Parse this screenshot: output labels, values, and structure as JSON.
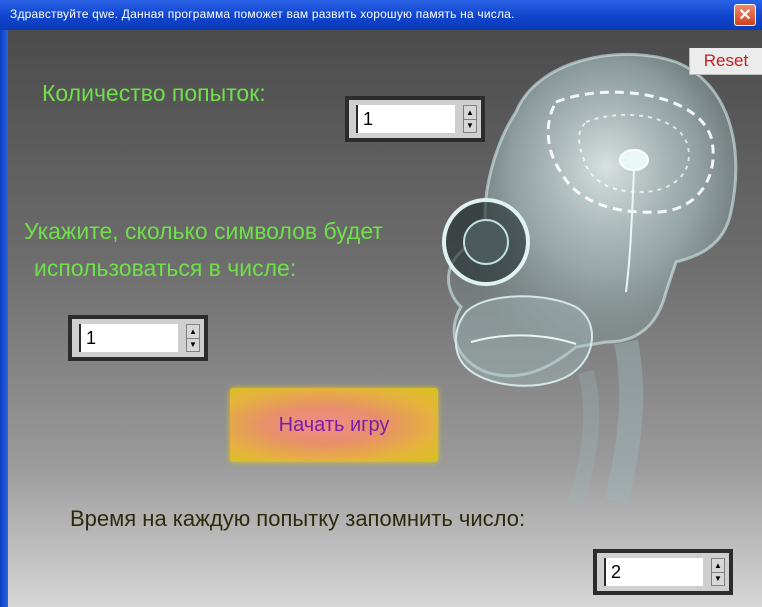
{
  "window": {
    "title": "Здравствуйте qwe. Данная программа поможет вам развить хорошую память на числа.",
    "close_icon": "✕"
  },
  "reset_label": "Reset",
  "attempts": {
    "label": "Количество попыток:",
    "value": "1"
  },
  "digits": {
    "label_line1": "Укажите, сколько символов будет",
    "label_line2": "использоваться в числе:",
    "value": "1"
  },
  "start_button_label": "Начать игру",
  "time": {
    "label": "Время на каждую попытку запомнить число:",
    "value": "2"
  },
  "spinner_arrows": {
    "up": "▲",
    "down": "▼"
  },
  "colors": {
    "label_green": "#6fe04a",
    "title_bar_blue": "#0f44cc",
    "reset_red": "#c32020",
    "start_label_purple": "#7a1ea6"
  },
  "icons": {
    "background_image": "x-ray-skull-illustration"
  }
}
